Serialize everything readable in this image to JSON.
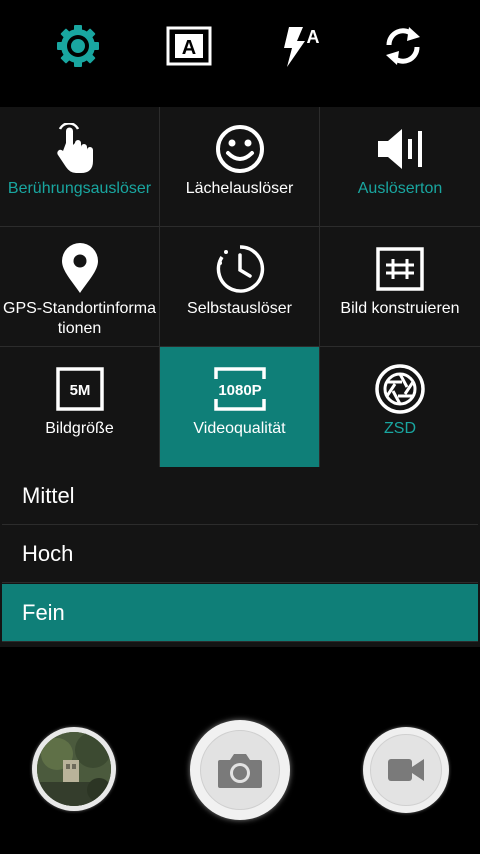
{
  "colors": {
    "accent": "#0f7f78",
    "accent_text": "#19a6a0",
    "panel": "#141414"
  },
  "top_bar": {
    "icons": [
      "settings-icon",
      "scene-auto-icon",
      "flash-auto-icon",
      "switch-camera-icon"
    ],
    "scene_badge": "A",
    "flash_badge": "A"
  },
  "settings_grid": {
    "items": [
      {
        "label": "Berührungsauslöser",
        "icon": "touch-shutter-icon",
        "active": false,
        "highlighted_text": true
      },
      {
        "label": "Lächelauslöser",
        "icon": "smile-icon",
        "active": false,
        "highlighted_text": false
      },
      {
        "label": "Auslöserton",
        "icon": "speaker-icon",
        "active": false,
        "highlighted_text": true
      },
      {
        "label": "GPS-Standortinformationen",
        "icon": "location-pin-icon",
        "active": false,
        "highlighted_text": false
      },
      {
        "label": "Selbstauslöser",
        "icon": "timer-icon",
        "active": false,
        "highlighted_text": false
      },
      {
        "label": "Bild konstruieren",
        "icon": "grid-frame-icon",
        "active": false,
        "highlighted_text": false
      },
      {
        "label": "Bildgröße",
        "icon": "image-size-icon",
        "active": false,
        "highlighted_text": false,
        "badge": "5M"
      },
      {
        "label": "Videoqualität",
        "icon": "video-quality-icon",
        "active": true,
        "highlighted_text": false,
        "badge": "1080P"
      },
      {
        "label": "ZSD",
        "icon": "aperture-icon",
        "active": false,
        "highlighted_text": true
      }
    ]
  },
  "video_quality_options": {
    "items": [
      "Mittel",
      "Hoch",
      "Fein"
    ],
    "selected": "Fein"
  },
  "bottom_bar": {
    "gallery_thumbnail": "gallery-thumbnail",
    "shutter": "camera-icon",
    "video": "video-camera-icon"
  }
}
